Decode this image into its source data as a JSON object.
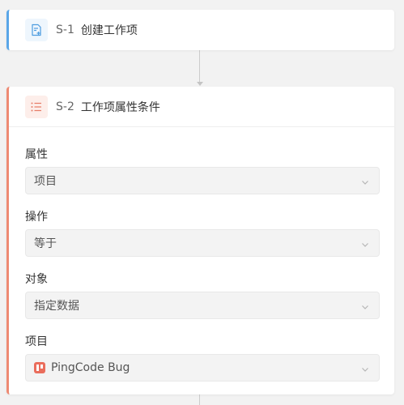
{
  "steps": [
    {
      "code": "S-1",
      "title": "创建工作项",
      "icon": "add-document-icon",
      "accent_color": "#5aa6e8"
    },
    {
      "code": "S-2",
      "title": "工作项属性条件",
      "icon": "list-icon",
      "accent_color": "#ee8a73",
      "fields": [
        {
          "label": "属性",
          "value": "项目"
        },
        {
          "label": "操作",
          "value": "等于"
        },
        {
          "label": "对象",
          "value": "指定数据"
        },
        {
          "label": "项目",
          "value": "PingCode Bug",
          "icon": "project-icon"
        }
      ]
    }
  ]
}
